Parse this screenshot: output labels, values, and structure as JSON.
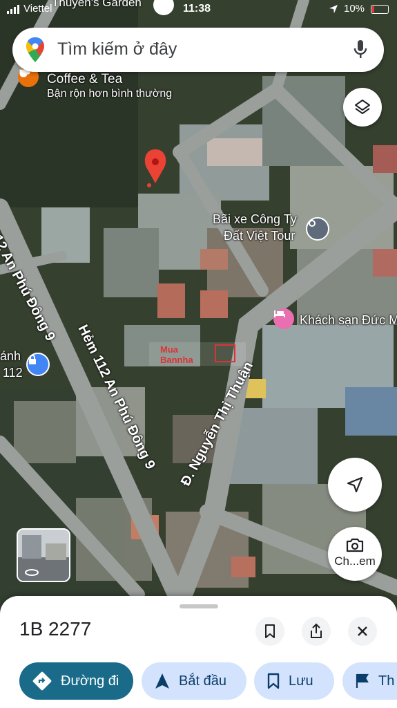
{
  "status_bar": {
    "carrier": "Viettel",
    "time": "11:38",
    "battery": "10%"
  },
  "top_place": {
    "label": "Thuyền's Garden"
  },
  "search": {
    "placeholder": "Tìm kiếm ở đây"
  },
  "pois": {
    "coffee": {
      "name": "Coffee & Tea",
      "subtitle": "Bận rộn hơn bình thường"
    },
    "parking": {
      "name_line1": "Bãi xe Công Ty",
      "name_line2": "Đất Việt Tour"
    },
    "hotel": {
      "name": "Khách sạn Đức M"
    },
    "left_place": {
      "line1": "ánh",
      "line2": "112"
    }
  },
  "roads": {
    "an_phu_dong_9_left": "12 An Phú Đông 9",
    "hem_112": "Hẻm 112 An Phú Đông 9",
    "nguyen_thi_thuan": "Đ. Nguyễn Thị Thuận"
  },
  "watermark": {
    "line1": "Mua",
    "line2": "Bannha"
  },
  "camera_button": {
    "label": "Ch...em"
  },
  "bottom_sheet": {
    "title": "1B 2277",
    "actions": [
      {
        "label": "Đường đi",
        "icon": "directions-icon"
      },
      {
        "label": "Bắt đầu",
        "icon": "navigation-arrow-icon"
      },
      {
        "label": "Lưu",
        "icon": "bookmark-icon"
      },
      {
        "label": "Th",
        "icon": "flag-icon"
      }
    ]
  },
  "colors": {
    "pin_red": "#ea4335",
    "directions_teal": "#1a6b8a",
    "chip_blue": "#d3e3fd",
    "hotel_pink": "#e96fb1"
  }
}
